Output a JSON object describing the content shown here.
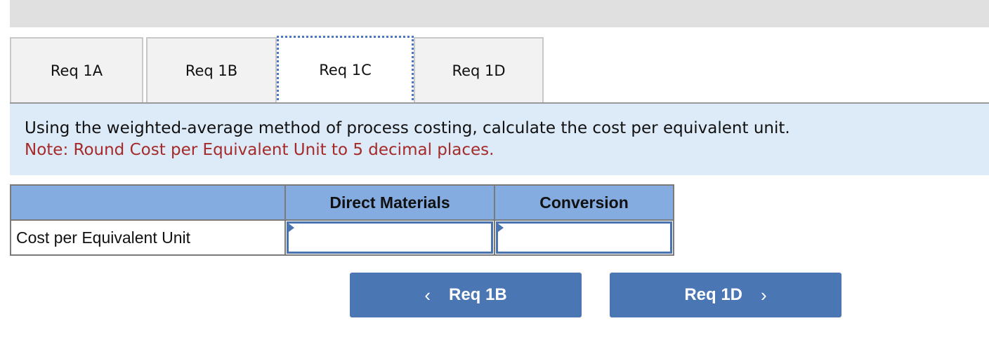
{
  "tabs": [
    {
      "label": "Req 1A",
      "active": false
    },
    {
      "label": "Req 1B",
      "active": false
    },
    {
      "label": "Req 1C",
      "active": true
    },
    {
      "label": "Req 1D",
      "active": false
    }
  ],
  "instructions": {
    "question": "Using the weighted-average method of process costing, calculate the cost per equivalent unit.",
    "note": "Note: Round Cost per Equivalent Unit to 5 decimal places."
  },
  "table": {
    "headers": [
      "",
      "Direct Materials",
      "Conversion"
    ],
    "rows": [
      {
        "label": "Cost per Equivalent Unit",
        "direct_materials": "",
        "conversion": ""
      }
    ]
  },
  "navigation": {
    "prev": {
      "label": "Req 1B",
      "icon": "chevron-left-icon",
      "glyph": "‹"
    },
    "next": {
      "label": "Req 1D",
      "icon": "chevron-right-icon",
      "glyph": "›"
    }
  },
  "colors": {
    "header_fill": "#84ace0",
    "instruction_bg": "#ddeaf7",
    "note_text": "#a52a2a",
    "button_fill": "#4a76b4",
    "active_tab_focus": "#4a78c0"
  }
}
